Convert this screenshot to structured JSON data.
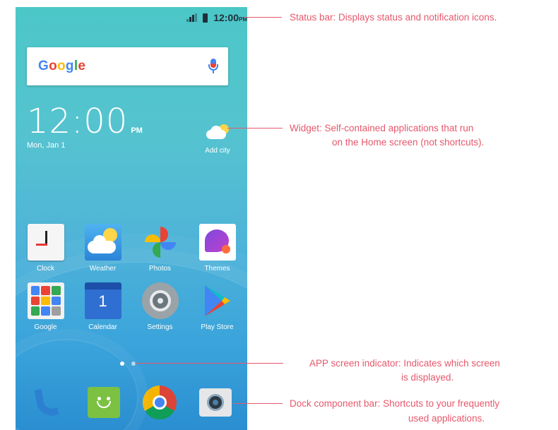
{
  "status_bar": {
    "time": "12:00",
    "ampm": "PM"
  },
  "search": {
    "logo": "Google"
  },
  "clock_widget": {
    "time": "12:00",
    "ampm": "PM",
    "date": "Mon, Jan 1"
  },
  "weather_widget": {
    "label": "Add city"
  },
  "apps": [
    {
      "label": "Clock",
      "icon": "clock-icon"
    },
    {
      "label": "Weather",
      "icon": "weather-icon"
    },
    {
      "label": "Photos",
      "icon": "pinwheel-icon"
    },
    {
      "label": "Themes",
      "icon": "themes-icon"
    },
    {
      "label": "Google",
      "icon": "google-folder-icon"
    },
    {
      "label": "Calendar",
      "icon": "calendar-icon",
      "badge": "1"
    },
    {
      "label": "Settings",
      "icon": "gear-icon"
    },
    {
      "label": "Play Store",
      "icon": "play-store-icon"
    }
  ],
  "dock": [
    {
      "icon": "phone-icon"
    },
    {
      "icon": "messages-icon"
    },
    {
      "icon": "chrome-icon"
    },
    {
      "icon": "camera-icon"
    }
  ],
  "callouts": {
    "status_bar": "Status bar: Displays status and notification icons.",
    "widget_line1": "Widget: Self-contained applications that run",
    "widget_line2": "on the Home screen (not shortcuts).",
    "indicator_line1": "APP screen indicator: Indicates which screen",
    "indicator_line2": "is displayed.",
    "dock_line1": "Dock component bar: Shortcuts to your frequently",
    "dock_line2": "used applications."
  },
  "colors": {
    "callout": "#e6586c",
    "screen_top": "#4cc7c8",
    "screen_bottom": "#2a8ed0"
  }
}
